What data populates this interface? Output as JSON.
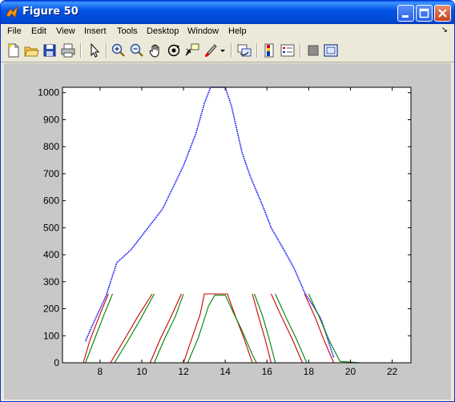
{
  "window": {
    "title": "Figure 50"
  },
  "menu": [
    "File",
    "Edit",
    "View",
    "Insert",
    "Tools",
    "Desktop",
    "Window",
    "Help"
  ],
  "toolbar": {
    "tools": [
      "new-figure-icon",
      "open-file-icon",
      "save-icon",
      "print-icon",
      "pointer-icon",
      "zoom-in-icon",
      "zoom-out-icon",
      "pan-hand-icon",
      "rotate-3d-icon",
      "data-cursor-icon",
      "brush-icon",
      "link-plot-icon",
      "colorbar-icon",
      "legend-icon",
      "hide-plot-tools-icon",
      "show-plot-tools-icon"
    ]
  },
  "chart_data": {
    "type": "line",
    "title": "",
    "xlabel": "",
    "ylabel": "",
    "xlim": [
      6.2,
      22.9
    ],
    "ylim": [
      0,
      1020
    ],
    "xticks": [
      8,
      10,
      12,
      14,
      16,
      18,
      20,
      22
    ],
    "yticks": [
      0,
      100,
      200,
      300,
      400,
      500,
      600,
      700,
      800,
      900,
      1000
    ],
    "grid": false,
    "legend": "none",
    "series": [
      {
        "color": "#0000ff",
        "style": "dotted",
        "x": [
          7.3,
          7.7,
          8.3,
          8.8,
          9.5,
          10.3,
          11.0,
          11.5,
          12.0,
          12.6,
          13.0,
          13.3,
          14.0,
          14.3,
          14.8,
          15.2,
          15.8,
          16.2,
          16.8,
          17.3,
          17.8,
          18.3,
          18.6,
          18.9,
          19.2
        ],
        "y": [
          80,
          150,
          250,
          370,
          420,
          500,
          570,
          650,
          730,
          850,
          960,
          1020,
          1020,
          950,
          780,
          690,
          580,
          500,
          420,
          350,
          260,
          200,
          160,
          90,
          20
        ]
      },
      {
        "color": "#cc0000",
        "style": "solid",
        "segments": [
          {
            "x": [
              7.2,
              7.5,
              8.0,
              8.4
            ],
            "y": [
              0,
              80,
              180,
              255
            ]
          },
          {
            "x": [
              8.5,
              9.2,
              9.8,
              10.5
            ],
            "y": [
              0,
              90,
              170,
              255
            ]
          },
          {
            "x": [
              10.4,
              10.9,
              11.4,
              11.9
            ],
            "y": [
              0,
              90,
              170,
              255
            ]
          },
          {
            "x": [
              12.0,
              12.4,
              12.8,
              13.0,
              14.1,
              14.5,
              14.9,
              15.3
            ],
            "y": [
              0,
              90,
              180,
              255,
              255,
              170,
              90,
              0
            ]
          },
          {
            "x": [
              15.3,
              15.6,
              15.9,
              16.2
            ],
            "y": [
              255,
              170,
              90,
              0
            ]
          },
          {
            "x": [
              16.2,
              16.7,
              17.2,
              17.7
            ],
            "y": [
              255,
              170,
              90,
              0
            ]
          },
          {
            "x": [
              17.8,
              18.3,
              18.7,
              19.2
            ],
            "y": [
              255,
              170,
              90,
              0
            ]
          }
        ]
      },
      {
        "color": "#008000",
        "style": "solid",
        "segments": [
          {
            "x": [
              7.3,
              7.7,
              8.2,
              8.6
            ],
            "y": [
              0,
              80,
              180,
              255
            ]
          },
          {
            "x": [
              8.7,
              9.4,
              10.0,
              10.6
            ],
            "y": [
              0,
              90,
              170,
              255
            ]
          },
          {
            "x": [
              10.6,
              11.1,
              11.6,
              12.0
            ],
            "y": [
              0,
              90,
              170,
              255
            ]
          },
          {
            "x": [
              12.2,
              12.7,
              13.2,
              13.5,
              14.0,
              14.3,
              14.8,
              15.3,
              15.5
            ],
            "y": [
              0,
              90,
              210,
              250,
              250,
              200,
              120,
              30,
              0
            ]
          },
          {
            "x": [
              15.4,
              15.8,
              16.1,
              16.4
            ],
            "y": [
              255,
              170,
              90,
              0
            ]
          },
          {
            "x": [
              16.4,
              16.9,
              17.4,
              17.9
            ],
            "y": [
              255,
              170,
              90,
              0
            ]
          },
          {
            "x": [
              18.0,
              18.5,
              19.0,
              19.5,
              20.5
            ],
            "y": [
              255,
              170,
              80,
              5,
              0
            ]
          }
        ]
      },
      {
        "color": "#ff0000",
        "style": "solid",
        "x": [
          19.3,
          22.9
        ],
        "y": [
          0,
          0
        ]
      }
    ]
  }
}
